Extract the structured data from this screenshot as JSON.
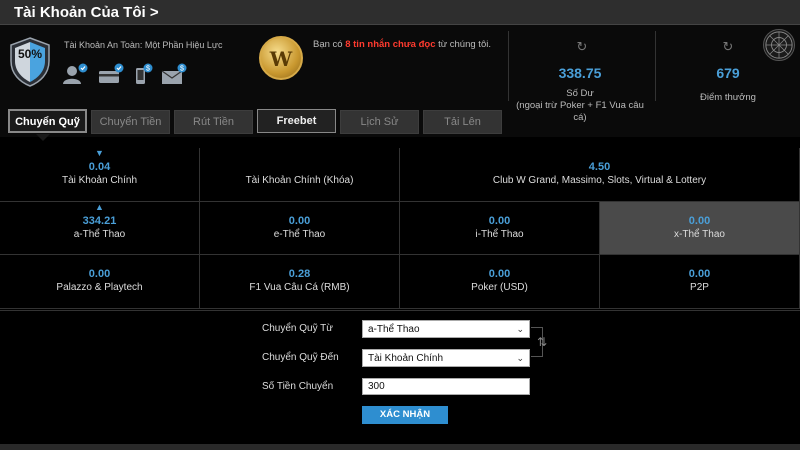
{
  "header": {
    "title": "Tài Khoản Của Tôi >"
  },
  "security": {
    "percent": "50%",
    "status_text": "Tài Khoản An Toàn: Một Phần Hiệu Lực",
    "icons": [
      "user-verified-icon",
      "card-verified-icon",
      "phone-dollar-icon",
      "email-dollar-icon"
    ]
  },
  "messages": {
    "badge_letter": "W",
    "prefix": "Bạn có ",
    "highlight": "8 tin nhắn chưa đọc",
    "suffix": " từ chúng tôi."
  },
  "balance": {
    "value": "338.75",
    "label_line1": "Số Dư",
    "label_line2": "(ngoại trừ Poker + F1 Vua câu",
    "label_line3": "cá)"
  },
  "points": {
    "value": "679",
    "label": "Điểm thưởng"
  },
  "tabs": [
    {
      "label": "Chuyển Quỹ",
      "state": "active"
    },
    {
      "label": "Chuyển Tiền",
      "state": "normal"
    },
    {
      "label": "Rút Tiền",
      "state": "normal"
    },
    {
      "label": "Freebet",
      "state": "free"
    },
    {
      "label": "Lịch Sử",
      "state": "normal"
    },
    {
      "label": "Tải Lên",
      "state": "normal"
    }
  ],
  "wallets": {
    "row1": [
      {
        "value": "0.04",
        "label": "Tài Khoản Chính",
        "arrow": "down"
      },
      {
        "value": "",
        "label": "Tài Khoản Chính (Khóa)"
      },
      {
        "value": "4.50",
        "label": "Club W Grand, Massimo, Slots, Virtual & Lottery"
      }
    ],
    "row2": [
      {
        "value": "334.21",
        "label": "a-Thể Thao",
        "arrow": "up"
      },
      {
        "value": "0.00",
        "label": "e-Thể Thao"
      },
      {
        "value": "0.00",
        "label": "i-Thể Thao"
      },
      {
        "value": "0.00",
        "label": "x-Thể Thao",
        "highlight": true
      }
    ],
    "row3": [
      {
        "value": "0.00",
        "label": "Palazzo & Playtech"
      },
      {
        "value": "0.28",
        "label": "F1 Vua Câu Cá (RMB)"
      },
      {
        "value": "0.00",
        "label": "Poker (USD)"
      },
      {
        "value": "0.00",
        "label": "P2P"
      }
    ]
  },
  "transfer_form": {
    "from_label": "Chuyển Quỹ Từ",
    "from_value": "a-Thể Thao",
    "to_label": "Chuyển Quỹ Đến",
    "to_value": "Tài Khoản Chính",
    "amount_label": "Số Tiền Chuyển",
    "amount_value": "300",
    "submit_label": "XÁC NHẬN"
  },
  "colors": {
    "accent": "#4a9fd8",
    "alert": "#ff3b2f",
    "button": "#2e8ed0",
    "highlight_cell": "#4a4a4a"
  }
}
